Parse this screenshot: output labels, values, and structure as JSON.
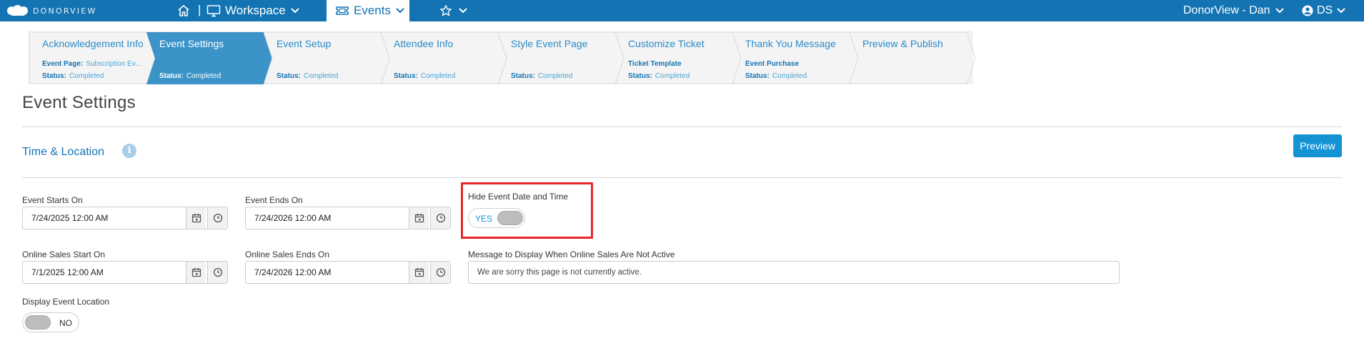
{
  "topbar": {
    "brand": "DONORVIEW",
    "workspace_label": "Workspace",
    "events_label": "Events",
    "user_label": "DonorView - Dan",
    "initials": "DS",
    "background_color": "#1474b3"
  },
  "wizard": {
    "steps": [
      {
        "title": "Acknowledgement Info",
        "detail_label": "Event Page:",
        "detail_value": "Subscription Ev...",
        "status_label": "Status:",
        "status_value": "Completed",
        "active": false
      },
      {
        "title": "Event Settings",
        "detail_label": "",
        "detail_value": "",
        "status_label": "Status:",
        "status_value": "Completed",
        "active": true
      },
      {
        "title": "Event Setup",
        "detail_label": "",
        "detail_value": "",
        "status_label": "Status:",
        "status_value": "Completed",
        "active": false
      },
      {
        "title": "Attendee Info",
        "detail_label": "",
        "detail_value": "",
        "status_label": "Status:",
        "status_value": "Completed",
        "active": false
      },
      {
        "title": "Style Event Page",
        "detail_label": "",
        "detail_value": "",
        "status_label": "Status:",
        "status_value": "Completed",
        "active": false
      },
      {
        "title": "Customize Ticket",
        "detail_label": "Ticket Template",
        "detail_value": "",
        "status_label": "Status:",
        "status_value": "Completed",
        "active": false
      },
      {
        "title": "Thank You Message",
        "detail_label": "Event Purchase",
        "detail_value": "",
        "status_label": "Status:",
        "status_value": "Completed",
        "active": false
      },
      {
        "title": "Preview & Publish",
        "detail_label": "",
        "detail_value": "",
        "status_label": "",
        "status_value": "",
        "active": false
      }
    ],
    "active_color": "#3b93c8"
  },
  "page": {
    "title": "Event Settings",
    "section_title": "Time & Location",
    "preview_button": "Preview"
  },
  "form": {
    "event_starts": {
      "label": "Event Starts On",
      "value": "7/24/2025 12:00 AM"
    },
    "event_ends": {
      "label": "Event Ends On",
      "value": "7/24/2026 12:00 AM"
    },
    "hide_date_time": {
      "label": "Hide Event Date and Time",
      "state": "YES"
    },
    "online_sales_start": {
      "label": "Online Sales Start On",
      "value": "7/1/2025 12:00 AM"
    },
    "online_sales_end": {
      "label": "Online Sales Ends On",
      "value": "7/24/2026 12:00 AM"
    },
    "inactive_message": {
      "label": "Message to Display When Online Sales Are Not Active",
      "value": "We are sorry this page is not currently active."
    },
    "display_location": {
      "label": "Display Event Location",
      "state": "NO"
    }
  },
  "icons": {
    "home": "home-icon",
    "monitor": "monitor-icon",
    "ticket": "ticket-icon",
    "star": "star-icon",
    "calendar": "calendar-icon",
    "clock": "clock-icon",
    "info": "info-icon",
    "user": "user-circle-icon"
  }
}
